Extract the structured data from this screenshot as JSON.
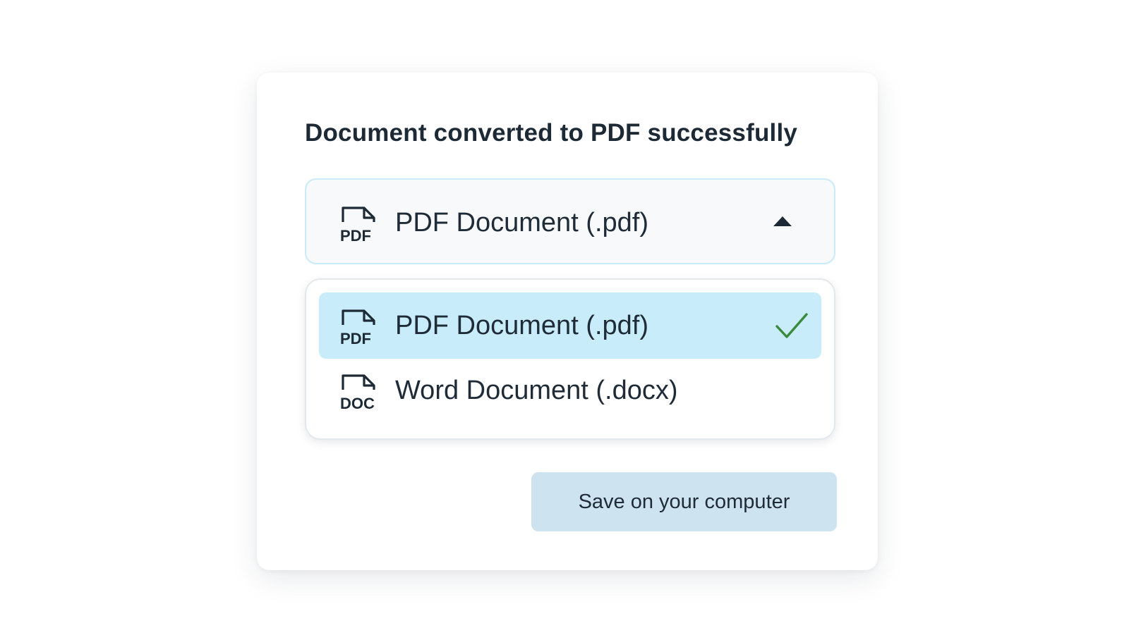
{
  "dialog": {
    "title": "Document converted to PDF successfully"
  },
  "format_select": {
    "selected_label": "PDF Document (.pdf)",
    "selected_icon": "pdf-file-icon",
    "expanded": true,
    "caret_icon": "caret-up-icon"
  },
  "format_options": [
    {
      "label": "PDF Document (.pdf)",
      "icon": "pdf-file-icon",
      "icon_text": "PDF",
      "selected": true,
      "selected_marker": "checkmark-icon"
    },
    {
      "label": "Word Document (.docx)",
      "icon": "doc-file-icon",
      "icon_text": "DOC",
      "selected": false
    }
  ],
  "actions": {
    "save_label": "Save on your computer"
  },
  "colors": {
    "selected_option_bg": "#c8ecfa",
    "select_border": "#c9ecf8",
    "save_button_bg": "#cde4f0",
    "checkmark": "#3a8a3e",
    "text": "#1d2a35"
  }
}
